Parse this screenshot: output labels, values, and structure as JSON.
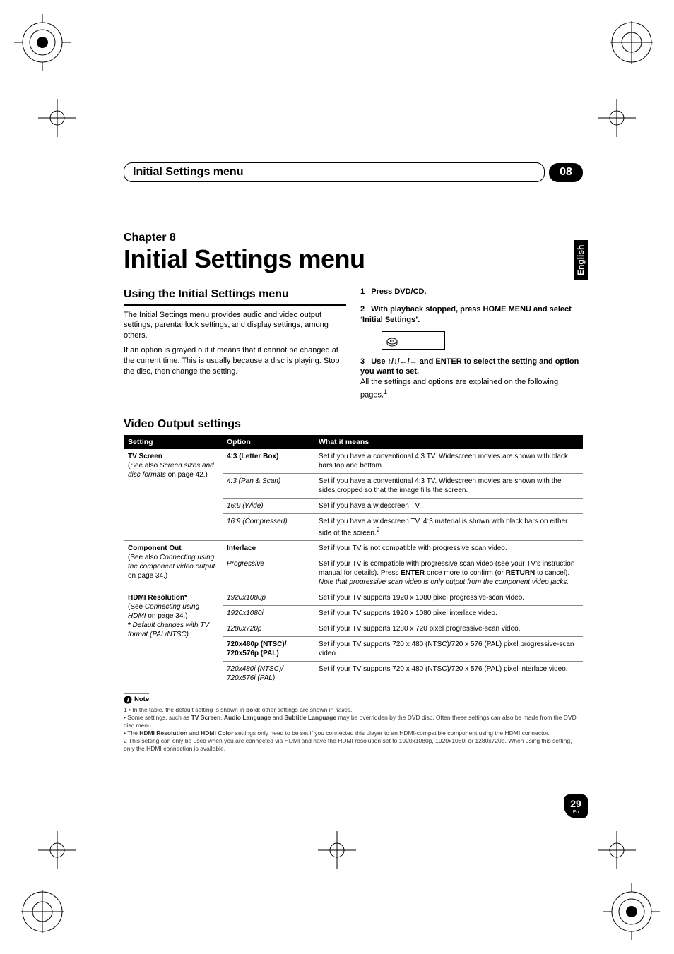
{
  "header": {
    "left": "Initial Settings menu",
    "right": "08"
  },
  "side_tab": "English",
  "chapter_label": "Chapter 8",
  "chapter_title": "Initial Settings menu",
  "left_col": {
    "h": "Using the Initial Settings menu",
    "p1": "The Initial Settings menu provides audio and video output settings, parental lock settings, and display settings, among others.",
    "p2": "If an option is grayed out it means that it cannot be changed at the current time. This is usually because a disc is playing. Stop the disc, then change the setting."
  },
  "right_col": {
    "s1_num": "1",
    "s1": "Press DVD/CD.",
    "s2_num": "2",
    "s2": "With playback stopped, press HOME MENU and select ‘Initial Settings’.",
    "s3_num": "3",
    "s3a": "Use ",
    "s3b": " and ENTER to select the setting and option you want to set.",
    "p": "All the settings and options are explained on the following pages.",
    "sup": "1"
  },
  "settings_h": "Video Output settings",
  "table": {
    "head": [
      "Setting",
      "Option",
      "What it means"
    ],
    "groups": [
      {
        "setting_bold": "TV Screen",
        "setting_rest_a": "(See also ",
        "setting_rest_ital": "Screen sizes and disc formats",
        "setting_rest_b": " on page 42.)",
        "rows": [
          {
            "opt_bold": "4:3 (Letter Box)",
            "opt_ital": "",
            "mean": "Set if you have a conventional 4:3 TV. Widescreen movies are shown with black bars top and bottom."
          },
          {
            "opt_bold": "",
            "opt_ital": "4:3 (Pan & Scan)",
            "mean": "Set if you have a conventional 4:3 TV. Widescreen movies are shown with the sides cropped so that the image fills the screen."
          },
          {
            "opt_bold": "",
            "opt_ital": "16:9 (Wide)",
            "mean": "Set if you have a widescreen TV."
          },
          {
            "opt_bold": "",
            "opt_ital": "16:9 (Compressed)",
            "mean": "Set if you have a widescreen TV. 4:3 material is shown with black bars on either side of the screen.",
            "sup": "2"
          }
        ]
      },
      {
        "setting_bold": "Component Out",
        "setting_rest_a": "(See also ",
        "setting_rest_ital": "Connecting using the component video output",
        "setting_rest_b": " on page 34.)",
        "rows": [
          {
            "opt_bold": "Interlace",
            "opt_ital": "",
            "mean": "Set if your TV is not compatible with progressive scan video."
          },
          {
            "opt_bold": "",
            "opt_ital": "Progressive",
            "mean_parts": {
              "a": "Set if your TV is compatible with progressive scan video (see your TV’s instruction manual for details). Press ",
              "b": "ENTER",
              "c": " once more to confirm (or ",
              "d": "RETURN",
              "e": " to cancel).",
              "note": "Note that progressive scan video is only output from the component video jacks."
            }
          }
        ]
      },
      {
        "setting_bold": "HDMI Resolution*",
        "setting_rest_a": "(See ",
        "setting_rest_ital": "Connecting using HDMI",
        "setting_rest_b": " on page 34.)",
        "setting_extra_bold": "*",
        "setting_extra_ital": " Default changes with TV format (PAL/NTSC).",
        "rows": [
          {
            "opt_bold": "",
            "opt_ital": "1920x1080p",
            "mean": "Set if your TV supports 1920 x 1080 pixel progressive-scan video."
          },
          {
            "opt_bold": "",
            "opt_ital": "1920x1080i",
            "mean": "Set if your TV supports 1920 x 1080 pixel interlace video."
          },
          {
            "opt_bold": "",
            "opt_ital": "1280x720p",
            "mean": "Set if your TV supports 1280 x 720 pixel progressive-scan video."
          },
          {
            "opt_bold": "720x480p (NTSC)/ 720x576p (PAL)",
            "opt_ital": "",
            "mean": "Set if your TV supports 720 x 480 (NTSC)/720 x 576 (PAL) pixel progressive-scan video."
          },
          {
            "opt_bold": "",
            "opt_ital": "720x480i (NTSC)/ 720x576i (PAL)",
            "mean": "Set if your TV supports 720 x 480 (NTSC)/720 x 576 (PAL) pixel interlace video."
          }
        ]
      }
    ]
  },
  "notes": {
    "label": "Note",
    "n1a": "1 • In the table, the default setting is shown in ",
    "n1b": "bold",
    "n1c": "; other settings are shown in ",
    "n1d": "italics",
    "n1e": ".",
    "n2a": "  • Some settings, such as ",
    "n2b": "TV Screen",
    "n2c": ", ",
    "n2d": "Audio Language",
    "n2e": " and ",
    "n2f": "Subtitle Language",
    "n2g": " may be overridden by the DVD disc. Often these settings can also be made from the DVD disc menu.",
    "n3a": "  • The ",
    "n3b": "HDMI Resolution",
    "n3c": " and ",
    "n3d": "HDMI Color",
    "n3e": " settings only need to be set if you connected this player to an HDMI-compatible component using the HDMI connector.",
    "n4": "2  This setting can only be used when you are connected via HDMI and have the HDMI resolution set to 1920x1080p, 1920x1080i or 1280x720p. When using this setting, only the HDMI connection is available."
  },
  "page_num": "29",
  "page_lang": "En"
}
